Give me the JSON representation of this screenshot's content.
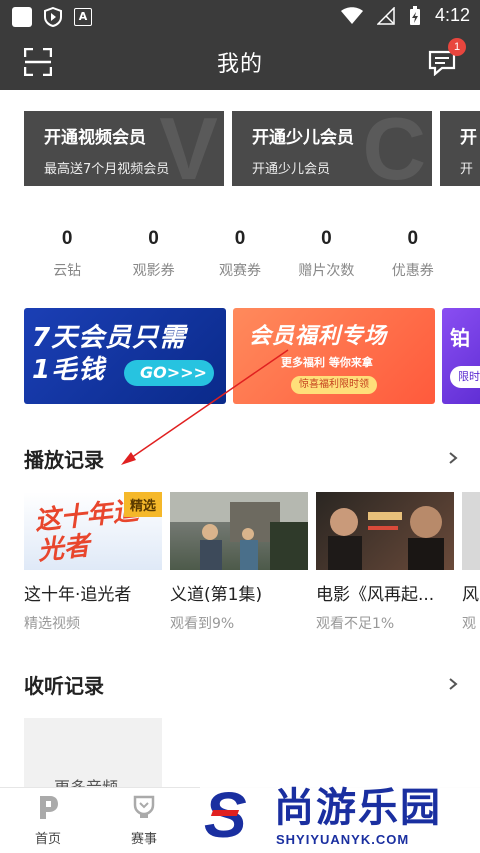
{
  "status_bar": {
    "time": "4:12"
  },
  "header": {
    "title": "我的",
    "message_badge": "1"
  },
  "members": [
    {
      "title": "开通视频会员",
      "subtitle": "最高送7个月视频会员",
      "deco": "V"
    },
    {
      "title": "开通少儿会员",
      "subtitle": "开通少儿会员",
      "deco": "C"
    },
    {
      "title": "开",
      "subtitle": "开"
    }
  ],
  "stats": [
    {
      "value": "0",
      "label": "云钻"
    },
    {
      "value": "0",
      "label": "观影券"
    },
    {
      "value": "0",
      "label": "观赛券"
    },
    {
      "value": "0",
      "label": "赠片次数"
    },
    {
      "value": "0",
      "label": "优惠券"
    }
  ],
  "banners": [
    {
      "text_line1": "7天会员只需",
      "text_line2": "1毛钱",
      "button": "GO>>>"
    },
    {
      "title": "会员福利专场",
      "subtitle": "更多福利  等你来拿",
      "button": "惊喜福利限时领"
    },
    {
      "title": "铂",
      "button": "限时"
    }
  ],
  "play_history": {
    "title": "播放记录",
    "items": [
      {
        "thumb_text": "这十年追光者",
        "tag": "精选",
        "name": "这十年·追光者",
        "sub": "精选视频"
      },
      {
        "name": "义道(第1集)",
        "sub": "观看到9%"
      },
      {
        "name": "电影《风再起...",
        "sub": "观看不足1%"
      },
      {
        "name": "风",
        "sub": "观"
      }
    ]
  },
  "listen_history": {
    "title": "收听记录",
    "card_label": "更多音频"
  },
  "bottom_nav": [
    {
      "label": "首页"
    },
    {
      "label": "赛事"
    }
  ],
  "watermark": {
    "cn": "尚游乐园",
    "en": "SHYIYUANYK.COM",
    "logo": "S"
  },
  "colors": {
    "header_bg": "#3b3b3b",
    "badge": "#e8463e",
    "tag": "#f5b82a",
    "arrow": "#e02020"
  }
}
